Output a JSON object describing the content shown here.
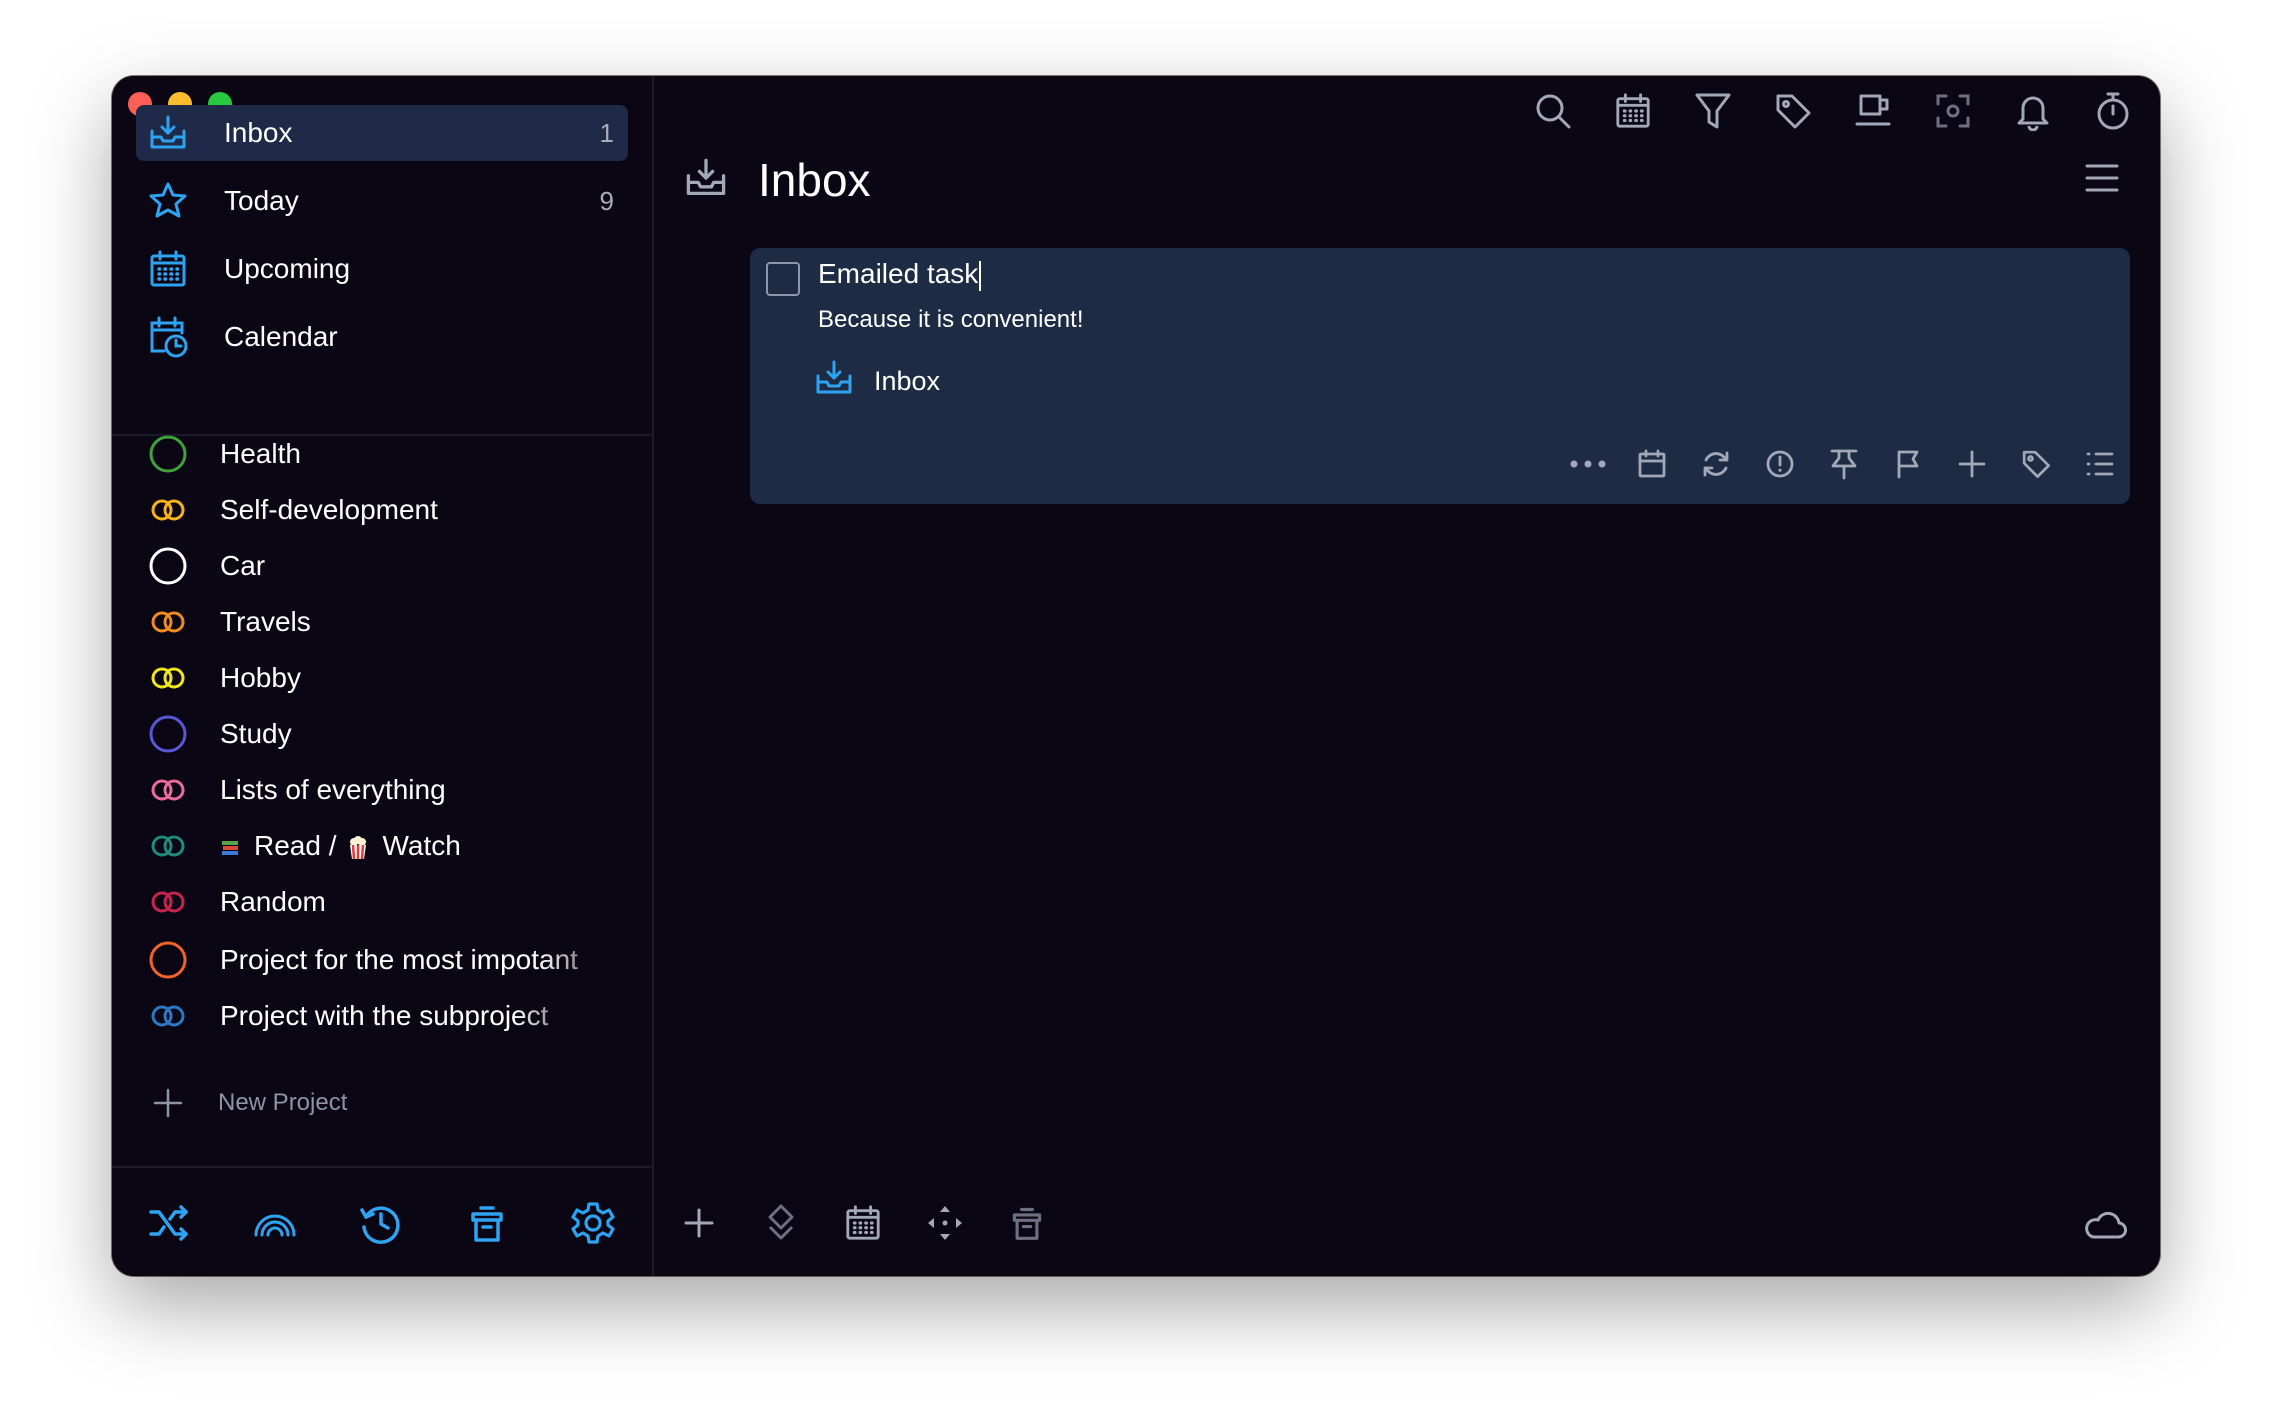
{
  "colors": {
    "accent": "#2ea3f2",
    "background": "#0a0613",
    "active_row": "#1e2a47",
    "card": "#1d2b44"
  },
  "sidebar": {
    "nav": [
      {
        "label": "Inbox",
        "count": "1",
        "icon": "inbox-tray-icon",
        "active": true
      },
      {
        "label": "Today",
        "count": "9",
        "icon": "star-icon"
      },
      {
        "label": "Upcoming",
        "count": "",
        "icon": "calendar-grid-icon"
      },
      {
        "label": "Calendar",
        "count": "",
        "icon": "calendar-clock-icon"
      }
    ],
    "projects": [
      {
        "label": "Health",
        "icon": "single-circle-icon",
        "color": "#3fa23d"
      },
      {
        "label": "Self-development",
        "icon": "double-ring-icon",
        "color": "#f5b31a"
      },
      {
        "label": "Car",
        "icon": "single-circle-icon",
        "color": "#ffffff"
      },
      {
        "label": "Travels",
        "icon": "double-ring-icon",
        "color": "#f08b1c"
      },
      {
        "label": "Hobby",
        "icon": "double-ring-icon",
        "color": "#f0e61c"
      },
      {
        "label": "Study",
        "icon": "single-circle-icon",
        "color": "#5857d6"
      },
      {
        "label": "Lists of everything",
        "icon": "double-ring-icon",
        "color": "#ea6a9a"
      },
      {
        "label_part1": "Read /",
        "label_part2": "Watch",
        "icon": "double-ring-icon",
        "color": "#1d8a7a"
      },
      {
        "label": "Random",
        "icon": "double-ring-icon",
        "color": "#c8234f"
      },
      {
        "label": "Project for the most impotant",
        "icon": "single-circle-icon",
        "color": "#f0632a"
      },
      {
        "label": "Project with the subproject",
        "icon": "double-ring-icon",
        "color": "#2a78c8"
      }
    ],
    "new_project_label": "New Project",
    "toolbar": [
      "shuffle-icon",
      "rainbow-icon",
      "history-icon",
      "trash-icon",
      "settings-gear-icon"
    ]
  },
  "main": {
    "title": "Inbox",
    "top_toolbar": [
      "search-icon",
      "calendar-grid-icon",
      "filter-icon",
      "tag-icon",
      "coffee-mug-icon",
      "focus-scan-icon",
      "bell-icon",
      "stopwatch-icon",
      "copy-windows-icon"
    ],
    "task": {
      "title": "Emailed task",
      "note": "Because it is convenient!",
      "project": "Inbox",
      "tools": [
        "more-dots-icon",
        "calendar-icon",
        "repeat-icon",
        "priority-icon",
        "pin-icon",
        "flag-icon",
        "add-subtask-icon",
        "tag-icon",
        "checklist-icon"
      ]
    },
    "bottom_toolbar": [
      "plus-icon",
      "move-priority-icon",
      "calendar-grid-icon",
      "move-arrows-icon",
      "trash-icon"
    ],
    "sync_icon": "cloud-icon"
  }
}
